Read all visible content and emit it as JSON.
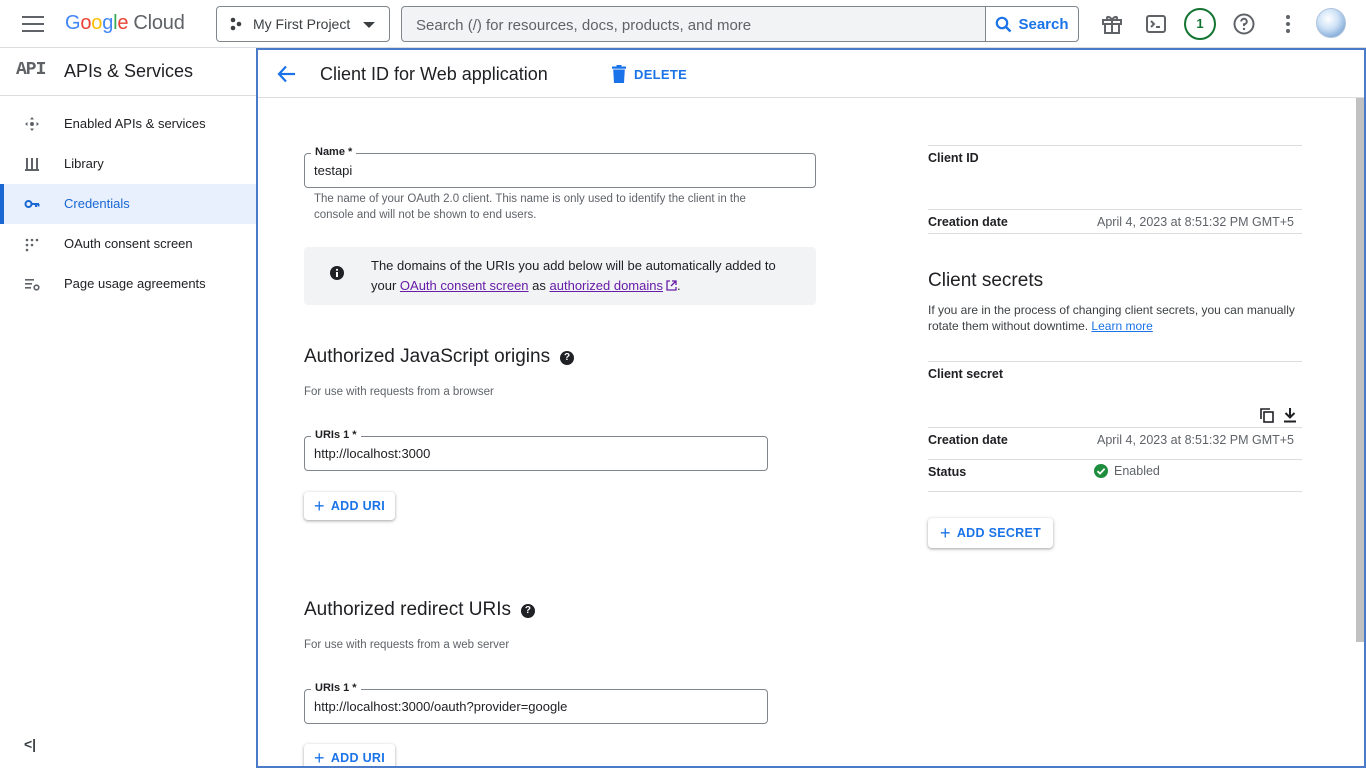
{
  "topbar": {
    "logo": {
      "g": "G",
      "o1": "o",
      "o2": "o",
      "g2": "g",
      "l": "l",
      "e": "e",
      "cloud": "Cloud"
    },
    "project_name": "My First Project",
    "search_placeholder": "Search (/) for resources, docs, products, and more",
    "search_button": "Search",
    "notification_count": "1"
  },
  "sidebar": {
    "api_logo": "API",
    "title": "APIs & Services",
    "items": [
      {
        "label": "Enabled APIs & services",
        "icon": "apis-services-icon"
      },
      {
        "label": "Library",
        "icon": "library-icon"
      },
      {
        "label": "Credentials",
        "icon": "key-icon",
        "active": true
      },
      {
        "label": "OAuth consent screen",
        "icon": "consent-icon"
      },
      {
        "label": "Page usage agreements",
        "icon": "settings-list-icon"
      }
    ],
    "collapse_glyph": "<|"
  },
  "header": {
    "title": "Client ID for Web application",
    "delete_label": "DELETE"
  },
  "form": {
    "name_label": "Name *",
    "name_value": "testapi",
    "name_hint": "The name of your OAuth 2.0 client. This name is only used to identify the client in the console and will not be shown to end users.",
    "info": {
      "text_before": "The domains of the URIs you add below will be automatically added to your ",
      "link1": "OAuth consent screen",
      "text_mid": " as ",
      "link2": "authorized domains",
      "text_after": "."
    },
    "js_origins": {
      "title": "Authorized JavaScript origins",
      "subtitle": "For use with requests from a browser",
      "uri_label": "URIs 1 *",
      "uri_value": "http://localhost:3000",
      "add_button": "ADD URI"
    },
    "redirect": {
      "title": "Authorized redirect URIs",
      "subtitle": "For use with requests from a web server",
      "uri_label": "URIs 1 *",
      "uri_value": "http://localhost:3000/oauth?provider=google",
      "add_button": "ADD URI"
    }
  },
  "details": {
    "client_id_label": "Client ID",
    "creation_date_label": "Creation date",
    "creation_date_value": "April 4, 2023 at 8:51:32 PM GMT+5",
    "secrets_title": "Client secrets",
    "secrets_desc": "If you are in the process of changing client secrets, you can manually rotate them without downtime. ",
    "learn_more": "Learn more",
    "client_secret_label": "Client secret",
    "secret_creation_label": "Creation date",
    "secret_creation_value": "April 4, 2023 at 8:51:32 PM GMT+5",
    "status_label": "Status",
    "status_value": "Enabled",
    "add_secret_button": "ADD SECRET"
  },
  "colors": {
    "accent": "#1a73e8",
    "active_bg": "#e8f0fe",
    "enabled_green": "#1e8e3e",
    "focus_border": "#4a7ac8"
  }
}
